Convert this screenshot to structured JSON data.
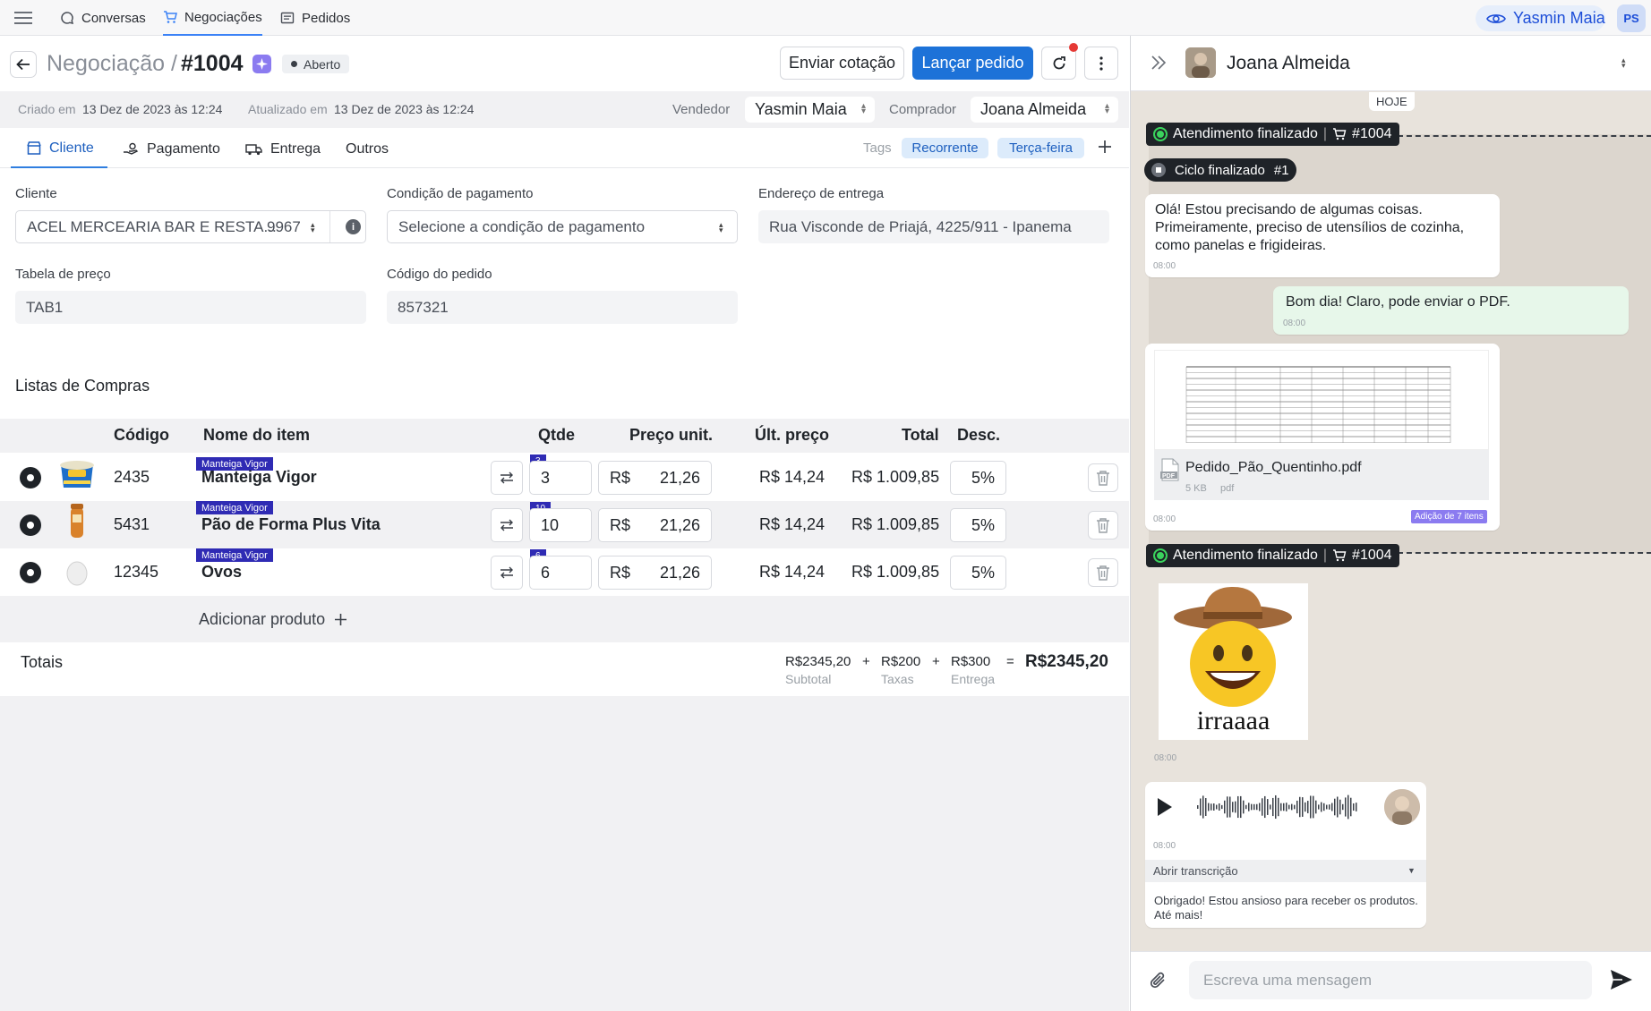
{
  "nav": {
    "tabs": [
      {
        "label": "Conversas"
      },
      {
        "label": "Negociações"
      },
      {
        "label": "Pedidos"
      }
    ],
    "user": "Yasmin Maia",
    "avatar_initials": "PS"
  },
  "header": {
    "breadcrumb": "Negociação /",
    "order_id": "#1004",
    "status": "Aberto",
    "send_quote": "Enviar cotação",
    "launch_order": "Lançar pedido"
  },
  "meta": {
    "created_label": "Criado em",
    "created_value": "13 Dez de 2023 às 12:24",
    "updated_label": "Atualizado em",
    "updated_value": "13 Dez de 2023 às 12:24",
    "seller_label": "Vendedor",
    "seller_value": "Yasmin Maia",
    "buyer_label": "Comprador",
    "buyer_value": "Joana Almeida"
  },
  "subtabs": [
    {
      "label": "Cliente"
    },
    {
      "label": "Pagamento"
    },
    {
      "label": "Entrega"
    },
    {
      "label": "Outros"
    }
  ],
  "tags": {
    "label": "Tags",
    "items": [
      "Recorrente",
      "Terça-feira"
    ]
  },
  "form": {
    "client_label": "Cliente",
    "client_value": "ACEL MERCEARIA BAR E RESTA...",
    "client_code": "9967",
    "payment_label": "Condição de pagamento",
    "payment_placeholder": "Selecione a condição de pagamento",
    "address_label": "Endereço de entrega",
    "address_value": "Rua Visconde de Priajá, 4225/911 - Ipanema",
    "price_table_label": "Tabela de preço",
    "price_table_value": "TAB1",
    "order_code_label": "Código do pedido",
    "order_code_value": "857321"
  },
  "list": {
    "title": "Listas de Compras",
    "headers": {
      "code": "Código",
      "name": "Nome do item",
      "qty": "Qtde",
      "unit_price": "Preço unit.",
      "last_price": "Últ. preço",
      "total": "Total",
      "discount": "Desc."
    },
    "rows": [
      {
        "code": "2435",
        "tag": "Manteiga Vigor",
        "name": "Manteiga Vigor",
        "qty_badge": "3",
        "qty": "3",
        "currency": "R$",
        "unit_price": "21,26",
        "last_price": "R$ 14,24",
        "total": "R$ 1.009,85",
        "discount": "5%"
      },
      {
        "code": "5431",
        "tag": "Manteiga Vigor",
        "name": "Pão de Forma Plus Vita",
        "qty_badge": "10",
        "qty": "10",
        "currency": "R$",
        "unit_price": "21,26",
        "last_price": "R$ 14,24",
        "total": "R$ 1.009,85",
        "discount": "5%"
      },
      {
        "code": "12345",
        "tag": "Manteiga Vigor",
        "name": "Ovos",
        "qty_badge": "6",
        "qty": "6",
        "currency": "R$",
        "unit_price": "21,26",
        "last_price": "R$ 14,24",
        "total": "R$ 1.009,85",
        "discount": "5%"
      }
    ],
    "add_product": "Adicionar produto"
  },
  "totals": {
    "label": "Totais",
    "subtotal": "R$2345,20",
    "subtotal_label": "Subtotal",
    "taxes": "R$200",
    "taxes_label": "Taxas",
    "delivery": "R$300",
    "delivery_label": "Entrega",
    "grand_total": "R$2345,20"
  },
  "chat": {
    "contact": "Joana Almeida",
    "day": "HOJE",
    "finished1": "Atendimento finalizado",
    "finished1_order": "#1004",
    "cycle": "Ciclo finalizado",
    "cycle_num": "#1",
    "msg1": "Olá! Estou precisando de algumas coisas. Primeiramente, preciso de utensílios de cozinha, como panelas e frigideiras.",
    "msg1_time": "08:00",
    "msg2": "Bom dia! Claro, pode enviar o PDF.",
    "msg2_time": "08:00",
    "file_name": "Pedido_Pão_Quentinho.pdf",
    "file_size": "5 KB",
    "file_type": "pdf",
    "file_time": "08:00",
    "file_badge": "Adição de 7 itens",
    "finished2": "Atendimento finalizado",
    "finished2_order": "#1004",
    "sticker_text": "irraaaa",
    "sticker_time": "08:00",
    "audio_time": "08:00",
    "transcript_label": "Abrir transcrição",
    "transcript": "Obrigado! Estou ansioso para receber os produtos. Até mais!",
    "composer_placeholder": "Escreva uma mensagem"
  },
  "colors": {
    "primary": "#1d72d8",
    "badge": "#2f2bb4",
    "dark": "#1f2328",
    "tag_bg": "#dcebfb",
    "chat_bg": "#e8e3dc",
    "mine_bubble": "#e7f7ea",
    "notify": "#e53935"
  }
}
